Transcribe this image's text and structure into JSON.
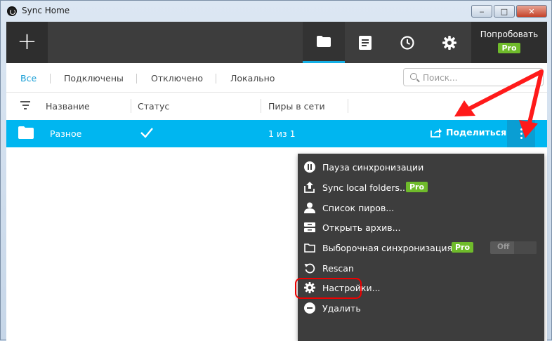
{
  "window": {
    "title": "Sync Home"
  },
  "toolbar": {
    "add_label": "+",
    "try_label": "Попробовать",
    "pro_label": "Pro"
  },
  "filters": {
    "all": "Все",
    "connected": "Подключены",
    "disabled": "Отключено",
    "local": "Локально"
  },
  "search": {
    "placeholder": "Поиск..."
  },
  "columns": {
    "name": "Название",
    "status": "Статус",
    "peers": "Пиры в сети"
  },
  "rows": [
    {
      "name": "Разное",
      "peers": "1 из 1"
    }
  ],
  "share_label": "Поделиться",
  "menu": {
    "pause": "Пауза синхронизации",
    "sync_local": "Sync local folders...",
    "peers_list": "Список пиров...",
    "open_archive": "Открыть архив...",
    "selective": "Выборочная синхронизация",
    "toggle_off": "Off",
    "rescan": "Rescan",
    "settings": "Настройки...",
    "delete": "Удалить"
  },
  "colors": {
    "accent": "#00b6f0",
    "toolbar": "#3d3d3d",
    "pro": "#6fbb2b",
    "annotation": "#ff0000"
  }
}
